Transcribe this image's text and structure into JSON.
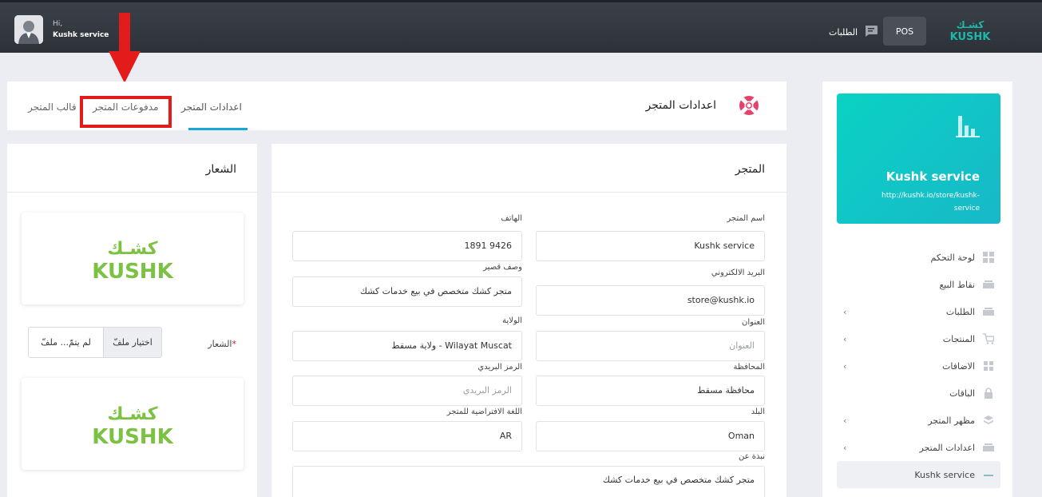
{
  "header": {
    "greeting": "Hi,",
    "user_name": "Kushk service",
    "orders_label": "الطلبات",
    "pos_label": "POS",
    "brand_ar": "كشـك",
    "brand_en": "KUSHK"
  },
  "sidebar": {
    "store_name": "Kushk service",
    "store_url": "http://kushk.io/store/kushk-service",
    "items": [
      {
        "label": "لوحة التحكم",
        "icon": "dashboard-icon",
        "chevron": false
      },
      {
        "label": "نقاط البيع",
        "icon": "pos-icon",
        "chevron": false
      },
      {
        "label": "الطلبات",
        "icon": "orders-icon",
        "chevron": true
      },
      {
        "label": "المنتجات",
        "icon": "cart-icon",
        "chevron": true
      },
      {
        "label": "الاضافات",
        "icon": "puzzle-icon",
        "chevron": true
      },
      {
        "label": "الباقات",
        "icon": "lock-icon",
        "chevron": false
      },
      {
        "label": "مظهر المتجر",
        "icon": "palette-icon",
        "chevron": true
      },
      {
        "label": "اعدادات المتجر",
        "icon": "settings-icon",
        "chevron": true
      },
      {
        "label": "Kushk service",
        "icon": "store-icon",
        "chevron": false
      }
    ]
  },
  "tabs": {
    "page_title": "اعدادات المتجر",
    "settings": "اعدادات المتجر",
    "payments": "مدفوعات المتجر",
    "template": "قالب المتجر"
  },
  "store_form": {
    "title": "المتجر",
    "store_name_label": "اسم المتجر",
    "store_name_value": "Kushk service",
    "phone_label": "الهاتف",
    "phone_value": "1891 9426",
    "email_label": "البريد الالكتروني",
    "email_value": "store@kushk.io",
    "short_desc_label": "وصف قصير",
    "short_desc_value": "متجر كشك متخصص في بيع خدمات كشك",
    "address_label": "العنوان",
    "address_placeholder": "العنوان",
    "state_label": "الولاية",
    "state_value": "ولاية مسقط - Wilayat Muscat",
    "governorate_label": "المحافظة",
    "governorate_value": "محافظة مسقط",
    "postal_label": "الرمز البريدي",
    "postal_placeholder": "الرمز البريدي",
    "country_label": "البلد",
    "country_value": "Oman",
    "language_label": "اللغة الافتراضية للمتجر",
    "language_value": "AR",
    "about_label": "نبذة عن",
    "about_value": "متجر كشك متخصص في بيع خدمات كشك"
  },
  "logo_panel": {
    "title": "الشعار",
    "logo_label": "الشعار",
    "required_mark": "*",
    "choose_file": "اختيار ملفّ",
    "no_file": "لم يتمّ... ملفّ",
    "logo_ar": "كشـك",
    "logo_en": "KUSHK"
  },
  "colors": {
    "accent": "#1aa6d6",
    "teal": "#0ad2c4",
    "brand_green": "#7cc242",
    "highlight_red": "#e31b1b"
  }
}
